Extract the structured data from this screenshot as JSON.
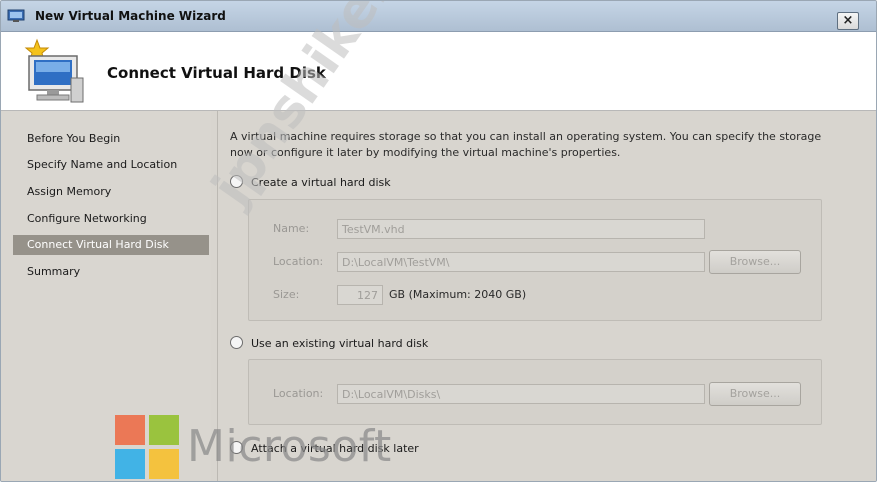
{
  "window": {
    "title": "New Virtual Machine Wizard",
    "close_label": "×"
  },
  "header": {
    "title": "Connect Virtual Hard Disk"
  },
  "nav": {
    "items": [
      {
        "label": "Before You Begin"
      },
      {
        "label": "Specify Name and Location"
      },
      {
        "label": "Assign Memory"
      },
      {
        "label": "Configure Networking"
      },
      {
        "label": "Connect Virtual Hard Disk"
      },
      {
        "label": "Summary"
      }
    ],
    "selected": "Connect Virtual Hard Disk"
  },
  "content": {
    "description": "A virtual machine requires storage so that you can install an operating system. You can specify the storage now or configure it later by modifying the virtual machine's properties.",
    "create_option": {
      "label": "Create a virtual hard disk",
      "name_label": "Name:",
      "name_value": "TestVM.vhd",
      "location_label": "Location:",
      "location_value": "D:\\LocalVM\\TestVM\\",
      "browse_label": "Browse...",
      "size_label": "Size:",
      "size_value": "127",
      "size_unit": "GB (Maximum: 2040 GB)"
    },
    "existing_option": {
      "label": "Use an existing virtual hard disk",
      "location_label": "Location:",
      "location_value": "D:\\LocalVM\\Disks\\",
      "browse_label": "Browse..."
    },
    "later_option": {
      "label": "Attach a virtual hard disk later"
    }
  },
  "overlay": {
    "logo_text": "Microsoft",
    "logo_colors": [
      "#f25022",
      "#7fba00",
      "#00a4ef",
      "#ffb900"
    ],
    "watermark_text": "jpnshiken.com"
  }
}
